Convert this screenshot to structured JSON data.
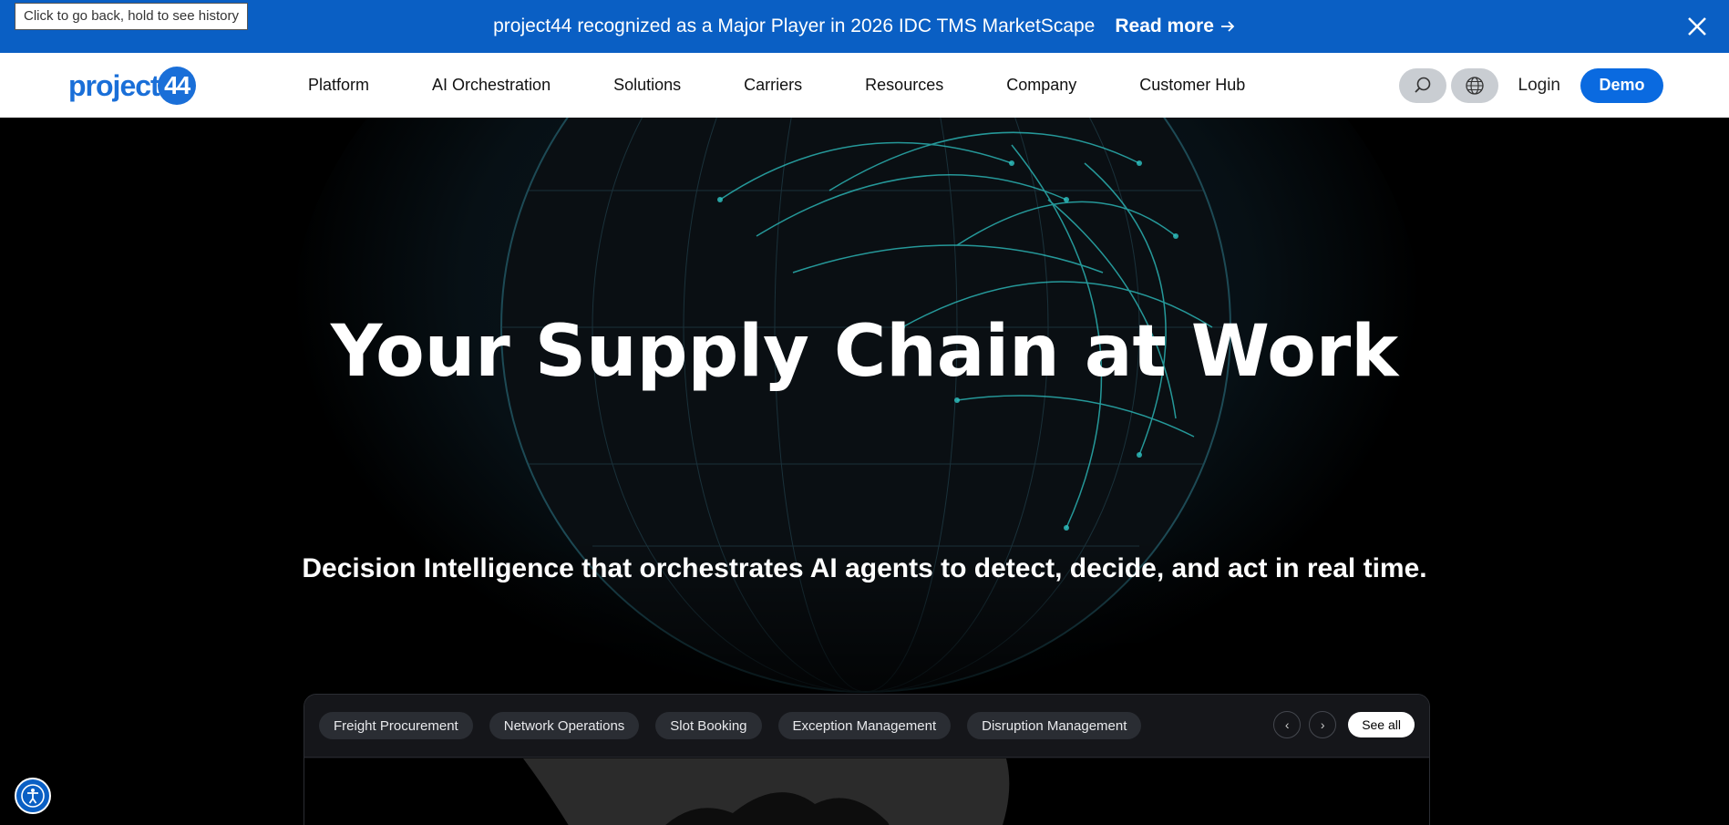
{
  "browser": {
    "back_tooltip": "Click to go back, hold to see history"
  },
  "announcement": {
    "text": "project44 recognized as a Major Player in 2026 IDC TMS MarketScape",
    "link_label": "Read more",
    "link_icon": "arrow-right-icon",
    "close_icon": "close-icon"
  },
  "nav": {
    "logo_text": "project",
    "logo_badge": "44",
    "items": [
      "Platform",
      "AI Orchestration",
      "Solutions",
      "Carriers",
      "Resources",
      "Company",
      "Customer Hub"
    ],
    "search_icon": "search-icon",
    "globe_icon": "globe-icon",
    "login_label": "Login",
    "demo_label": "Demo"
  },
  "hero": {
    "title": "Your Supply Chain at Work",
    "subtitle": "Decision Intelligence that orchestrates AI agents to detect, decide, and act in real time."
  },
  "tabs": {
    "items": [
      "Freight Procurement",
      "Network Operations",
      "Slot Booking",
      "Exception Management",
      "Disruption Management"
    ],
    "prev_label": "‹",
    "next_label": "›",
    "see_all_label": "See all"
  },
  "colors": {
    "brand_blue": "#0a5fc4",
    "demo_blue": "#0a6ae0",
    "globe_teal": "#2fc6c6"
  }
}
